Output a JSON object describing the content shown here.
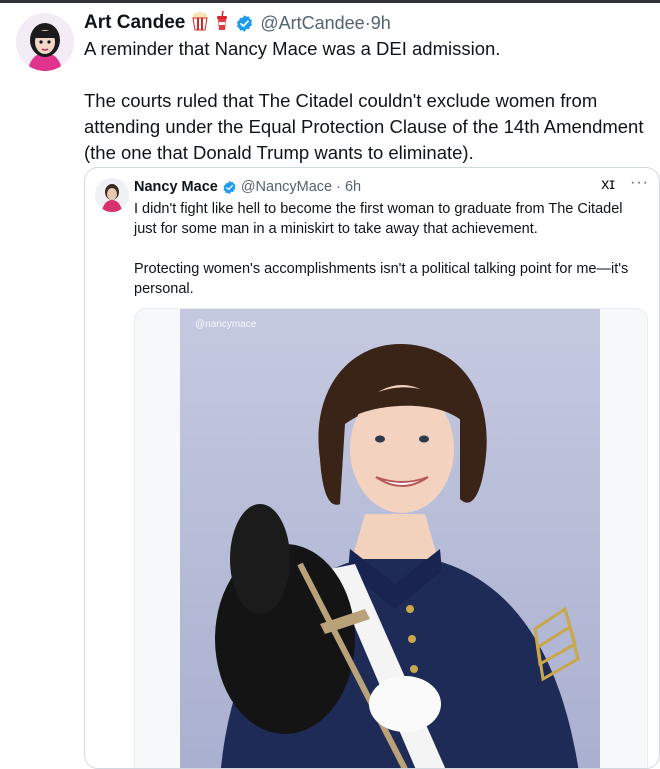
{
  "tweet": {
    "author_name": "Art Candee",
    "emoji_icons": [
      "popcorn-icon",
      "soda-icon"
    ],
    "handle": "@ArtCandee",
    "separator": "·",
    "time": "9h",
    "line1": "A reminder that Nancy Mace was a DEI admission.",
    "paragraph": "The courts ruled that The Citadel couldn't exclude women from attending under the Equal Protection Clause of the 14th Amendment (the one that Donald Trump wants to eliminate)."
  },
  "quoted": {
    "author_name": "Nancy Mace",
    "handle": "@NancyMace",
    "separator": "·",
    "time": "6h",
    "grok_label": "xɪ",
    "more_label": "···",
    "text1": "I didn't fight like hell to become the first woman to graduate from The Citadel just for some man in a miniskirt to take away that achievement.",
    "text2": "Protecting women's accomplishments isn't a political talking point for me—it's personal.",
    "image_watermark": "@nancymace"
  },
  "colors": {
    "verified_blue": "#1d9bf0",
    "secondary_text": "#536471",
    "uniform_navy": "#1f2b57",
    "photo_background": "#b8bdd6"
  }
}
